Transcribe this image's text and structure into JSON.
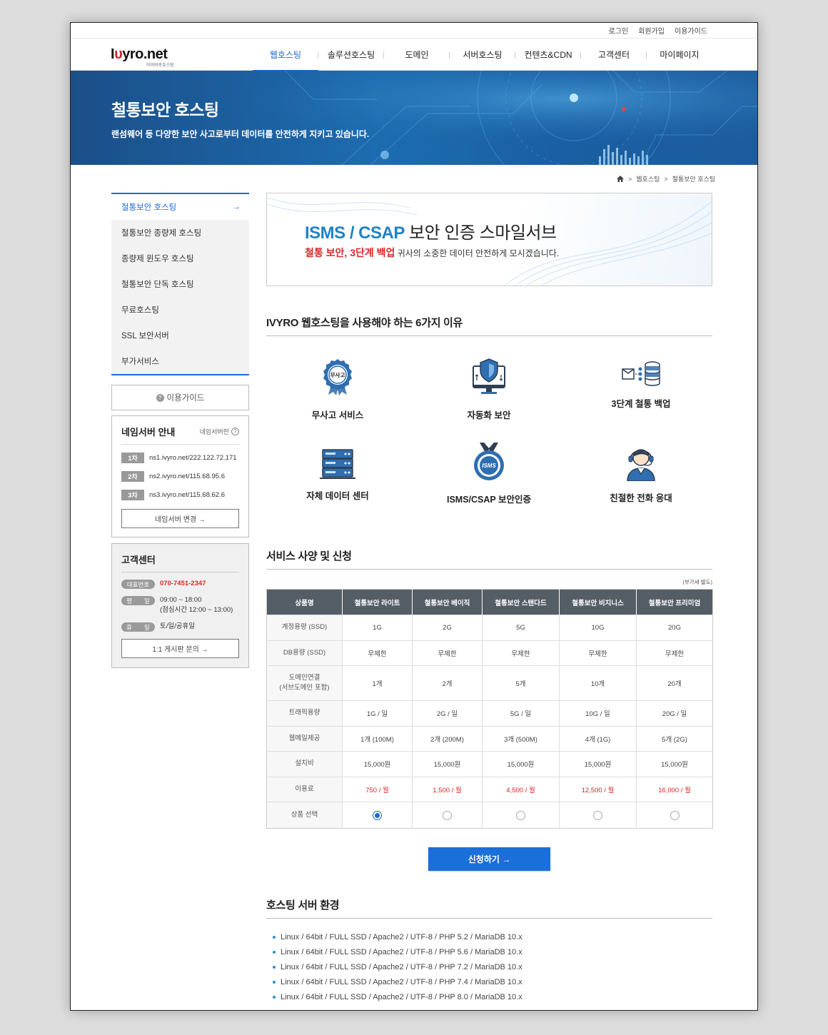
{
  "topbar": {
    "login": "로그인",
    "join": "회원가입",
    "guide": "이용가이드"
  },
  "logo": {
    "pre": "I",
    "mid": "ʀ",
    "text": "yro.net",
    "sub": "아이비로호스팅"
  },
  "gnb": [
    "웹호스팅",
    "솔루션호스팅",
    "도메인",
    "서버호스팅",
    "컨텐츠&CDN",
    "고객센터",
    "마이페이지"
  ],
  "banner": {
    "title": "철통보안 호스팅",
    "subtitle": "랜섬웨어 등 다양한 보안 사고로부터 데이터를 안전하게 지키고 있습니다."
  },
  "breadcrumb": [
    "웹호스팅",
    "철통보안 호스팅"
  ],
  "sidebar": {
    "items": [
      "철통보안 호스팅",
      "철통보안 종량제 호스팅",
      "종량제 윈도우 호스팅",
      "철통보안 단독 호스팅",
      "무료호스팅",
      "SSL 보안서버",
      "부가서비스"
    ],
    "guide_btn": "이용가이드",
    "ns": {
      "title": "네임서버 안내",
      "sub": "네임서버란",
      "rows": [
        {
          "tag": "1차",
          "value": "ns1.ivyro.net/222.122.72.171"
        },
        {
          "tag": "2차",
          "value": "ns2.ivyro.net/115.68.95.6"
        },
        {
          "tag": "3차",
          "value": "ns3.ivyro.net/115.68.62.6"
        }
      ],
      "btn": "네임서버 변경 →"
    },
    "cs": {
      "title": "고객센터",
      "rows": [
        {
          "tag": "대표번호",
          "value": "070-7451-2347"
        },
        {
          "tag": "평　　일",
          "value": "09:00 ~ 18:00",
          "value2": "(점심시간 12:00 ~ 13:00)"
        },
        {
          "tag": "휴　　일",
          "value": "토/일/공휴일"
        }
      ],
      "btn": "1:1 게시판 문의 →"
    }
  },
  "promo": {
    "brand": "ISMS / CSAP",
    "rest": " 보안 인증 스마일서브",
    "red": "철통 보안, 3단계 백업",
    "text": " 귀사의 소중한 데이터 안전하게 모시겠습니다."
  },
  "reasons": {
    "title": "IVYRO 웹호스팅을 사용해야 하는 6가지 이유",
    "items": [
      {
        "label": "무사고 서비스",
        "icon": "badge-icon",
        "badge_text": "무사고"
      },
      {
        "label": "자동화 보안",
        "icon": "monitor-shield-icon"
      },
      {
        "label": "3단계 철통 백업",
        "icon": "database-backup-icon"
      },
      {
        "label": "자체 데이터 센터",
        "icon": "server-rack-icon"
      },
      {
        "label": "ISMS/CSAP 보안인증",
        "icon": "isms-medal-icon",
        "badge_text": "ISMS"
      },
      {
        "label": "친절한 전화 응대",
        "icon": "headset-agent-icon"
      }
    ]
  },
  "spec": {
    "title": "서비스 사양 및 신청",
    "vat": "(부가세 별도)",
    "headers": [
      "상품명",
      "철통보안 라이트",
      "철통보안 베이직",
      "철통보안 스탠다드",
      "철통보안 비지니스",
      "철통보안 프리미엄"
    ],
    "rows": [
      {
        "label": "계정용량 (SSD)",
        "values": [
          "1G",
          "2G",
          "5G",
          "10G",
          "20G"
        ]
      },
      {
        "label": "DB용량 (SSD)",
        "values": [
          "무제한",
          "무제한",
          "무제한",
          "무제한",
          "무제한"
        ]
      },
      {
        "label": "도메인연결",
        "label2": "(서브도메인 포함)",
        "values": [
          "1개",
          "2개",
          "5개",
          "10개",
          "20개"
        ]
      },
      {
        "label": "트래픽용량",
        "values": [
          "1G / 일",
          "2G / 일",
          "5G / 일",
          "10G / 일",
          "20G / 일"
        ]
      },
      {
        "label": "웹메일제공",
        "values": [
          "1개 (100M)",
          "2개 (200M)",
          "3개 (500M)",
          "4개 (1G)",
          "5개 (2G)"
        ]
      },
      {
        "label": "설치비",
        "values": [
          "15,000원",
          "15,000원",
          "15,000원",
          "15,000원",
          "15,000원"
        ]
      },
      {
        "label": "이용료",
        "values": [
          "750 / 월",
          "1,500 / 월",
          "4,500 / 월",
          "12,500 / 월",
          "16,000 / 월"
        ],
        "red": true
      }
    ],
    "select_label": "상품 선택",
    "selected_index": 0,
    "apply_btn": "신청하기 →"
  },
  "env": {
    "title": "호스팅 서버 환경",
    "items": [
      "Linux / 64bit / FULL SSD / Apache2 / UTF-8 / PHP 5.2 / MariaDB 10.x",
      "Linux / 64bit / FULL SSD / Apache2 / UTF-8 / PHP 5.6 / MariaDB 10.x",
      "Linux / 64bit / FULL SSD / Apache2 / UTF-8 / PHP 7.2 / MariaDB 10.x",
      "Linux / 64bit / FULL SSD / Apache2 / UTF-8 / PHP 7.4 / MariaDB 10.x",
      "Linux / 64bit / FULL SSD / Apache2 / UTF-8 / PHP 8.0 / MariaDB 10.x"
    ]
  },
  "colors": {
    "accent": "#1b6bd8",
    "brand_red": "#d0202e",
    "price_red": "#d52a2a",
    "table_head": "#555d66"
  }
}
